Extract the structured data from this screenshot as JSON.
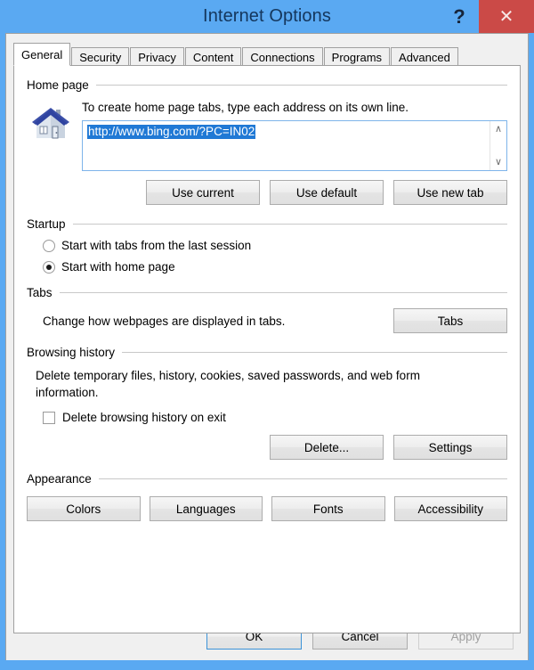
{
  "window": {
    "title": "Internet Options",
    "help_label": "?",
    "close_label": "✕",
    "titlebar_color": "#5aa9f2",
    "close_button_color": "#cb4a47",
    "title_text_color": "#14365c"
  },
  "tabs": [
    {
      "label": "General",
      "active": true
    },
    {
      "label": "Security",
      "active": false
    },
    {
      "label": "Privacy",
      "active": false
    },
    {
      "label": "Content",
      "active": false
    },
    {
      "label": "Connections",
      "active": false
    },
    {
      "label": "Programs",
      "active": false
    },
    {
      "label": "Advanced",
      "active": false
    }
  ],
  "home_page": {
    "group_label": "Home page",
    "icon": "house-icon",
    "description": "To create home page tabs, type each address on its own line.",
    "url_value": "http://www.bing.com/?PC=IN02",
    "url_selected": true,
    "selection_color": "#2079d5",
    "scroll_up": "∧",
    "scroll_down": "∨",
    "buttons": [
      {
        "label": "Use current"
      },
      {
        "label": "Use default"
      },
      {
        "label": "Use new tab"
      }
    ]
  },
  "startup": {
    "group_label": "Startup",
    "options": [
      {
        "label": "Start with tabs from the last session",
        "selected": false
      },
      {
        "label": "Start with home page",
        "selected": true
      }
    ]
  },
  "tabs_section": {
    "group_label": "Tabs",
    "description": "Change how webpages are displayed in tabs.",
    "button_label": "Tabs"
  },
  "browsing_history": {
    "group_label": "Browsing history",
    "description": "Delete temporary files, history, cookies, saved passwords, and web form information.",
    "checkbox_label": "Delete browsing history on exit",
    "checkbox_checked": false,
    "buttons": [
      {
        "label": "Delete..."
      },
      {
        "label": "Settings"
      }
    ]
  },
  "appearance": {
    "group_label": "Appearance",
    "buttons": [
      {
        "label": "Colors"
      },
      {
        "label": "Languages"
      },
      {
        "label": "Fonts"
      },
      {
        "label": "Accessibility"
      }
    ]
  },
  "footer": {
    "ok_label": "OK",
    "cancel_label": "Cancel",
    "apply_label": "Apply",
    "apply_disabled": true
  }
}
